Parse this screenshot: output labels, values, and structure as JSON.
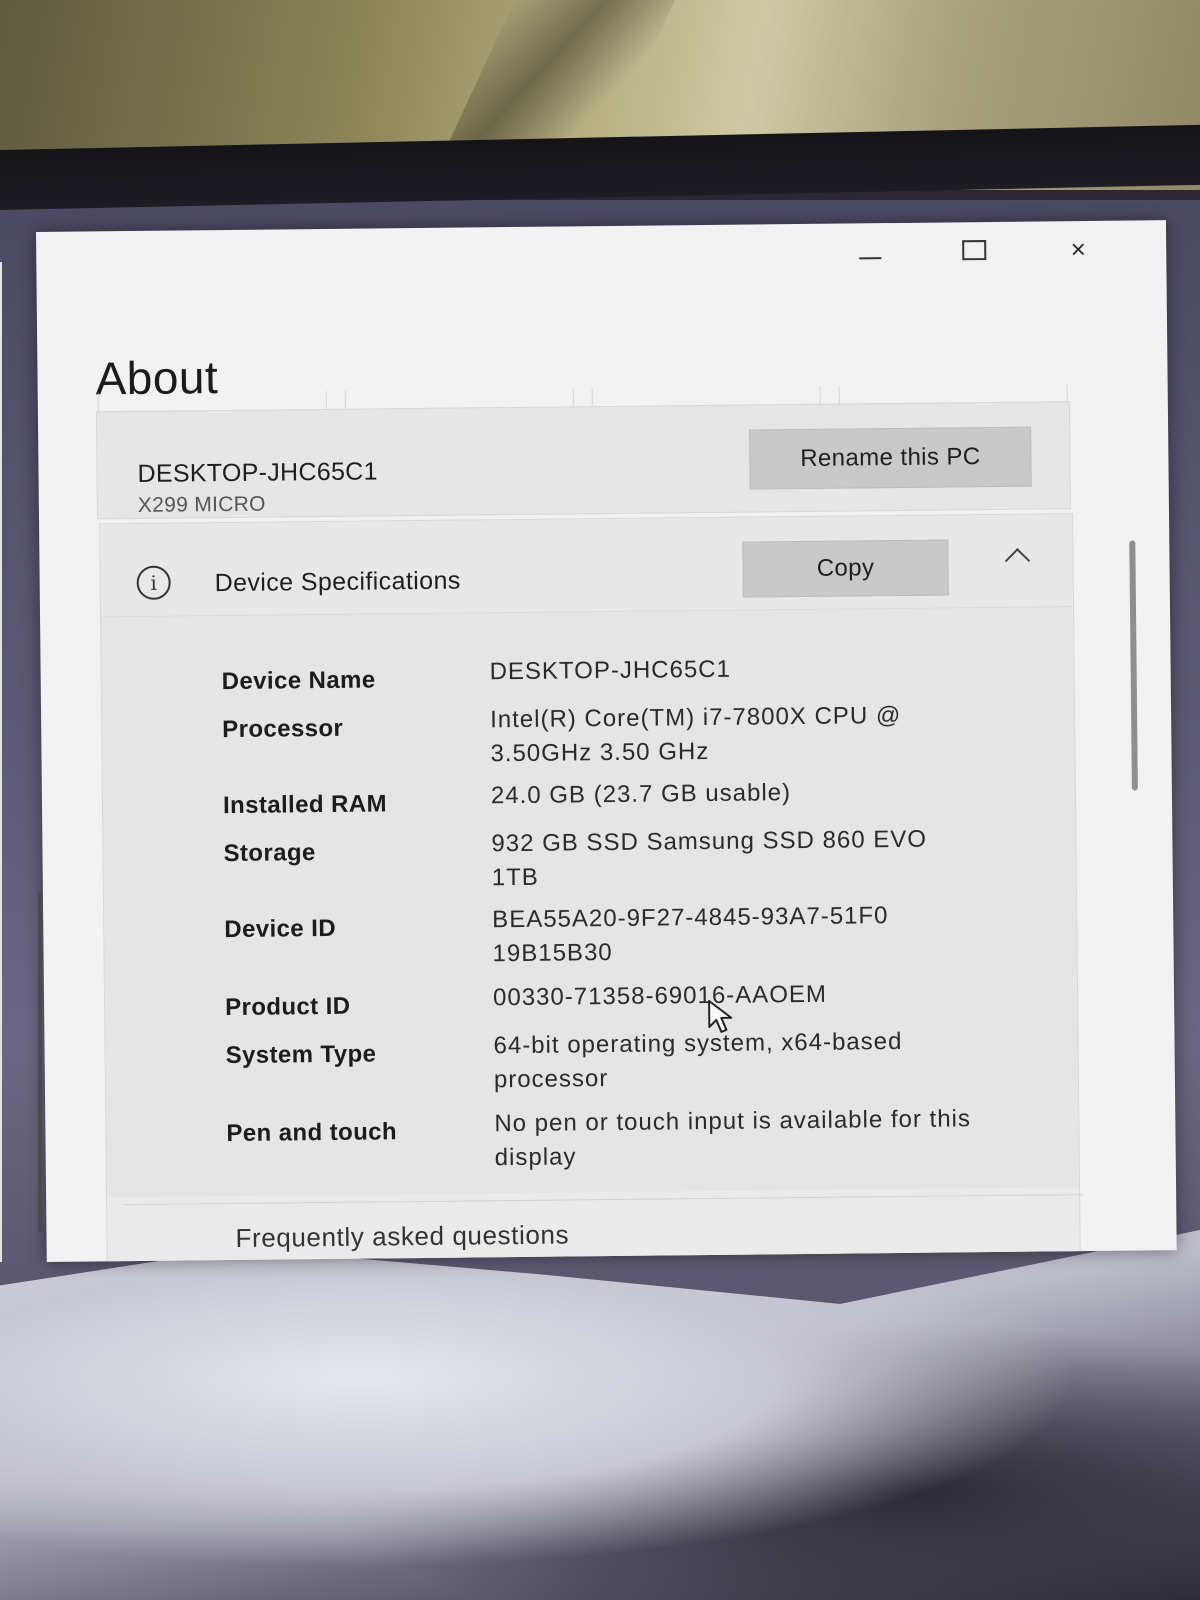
{
  "window": {
    "controls": {
      "minimize": "minimize",
      "maximize": "maximize",
      "close": "×"
    }
  },
  "page": {
    "title": "About"
  },
  "pc": {
    "name": "DESKTOP-JHC65C1",
    "model": "X299 MICRO",
    "rename_label": "Rename this PC"
  },
  "specs": {
    "title": "Device Specifications",
    "info_icon_glyph": "i",
    "copy_label": "Copy",
    "rows": [
      {
        "label": "Device Name",
        "value": "DESKTOP-JHC65C1"
      },
      {
        "label": "Processor",
        "value": "Intel(R)  Core(TM)  i7-7800X  CPU @ 3.50GHz   3.50 GHz"
      },
      {
        "label": "Installed RAM",
        "value": "24.0 GB (23.7 GB usable)"
      },
      {
        "label": "Storage",
        "value": "932  GB  SSD  Samsung  SSD  860 EVO 1TB"
      },
      {
        "label": "Device ID",
        "value": "BEA55A20-9F27-4845-93A7-51F0 19B15B30"
      },
      {
        "label": "Product ID",
        "value": "00330-71358-69016-AAOEM"
      },
      {
        "label": "System Type",
        "value": "64-bit  operating  system,  x64-based processor"
      },
      {
        "label": "Pen and touch",
        "value": "No pen or touch input is available for this display"
      }
    ]
  },
  "faq": {
    "label": "Frequently asked questions"
  },
  "colors": {
    "window_bg": "#f2f2f2",
    "card_bg": "#e6e6e6",
    "button_bg": "#c9c9c9",
    "text": "#1e1e1e"
  }
}
